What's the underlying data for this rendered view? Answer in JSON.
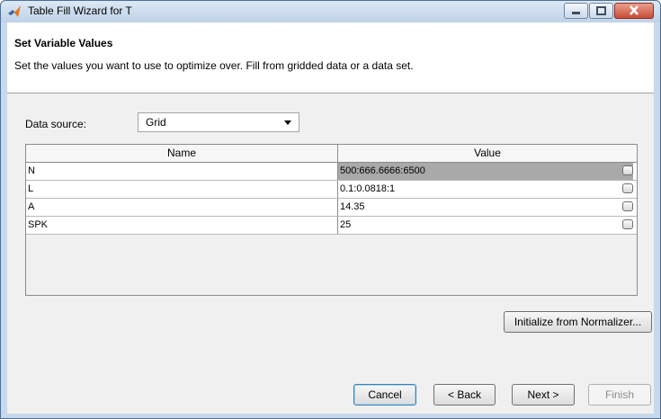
{
  "window": {
    "title": "Table Fill Wizard for T"
  },
  "header": {
    "title": "Set Variable Values",
    "description": "Set the values you want to use to optimize over. Fill from gridded data or a data set."
  },
  "data_source": {
    "label": "Data source:",
    "selected": "Grid"
  },
  "table": {
    "columns": [
      "Name",
      "Value"
    ],
    "rows": [
      {
        "name": "N",
        "value": "500:666.6666:6500",
        "selected": true
      },
      {
        "name": "L",
        "value": "0.1:0.0818:1",
        "selected": false
      },
      {
        "name": "A",
        "value": "14.35",
        "selected": false
      },
      {
        "name": "SPK",
        "value": "25",
        "selected": false
      }
    ]
  },
  "buttons": {
    "initialize": "Initialize from Normalizer...",
    "cancel": "Cancel",
    "back": "< Back",
    "next": "Next >",
    "finish": "Finish"
  },
  "icons": {
    "app": "matlab-logo-icon",
    "minimize": "minimize-icon",
    "maximize": "maximize-icon",
    "close": "close-icon",
    "dropdown": "chevron-down-icon",
    "cell_edit": "edit-cell-icon"
  },
  "colors": {
    "selected_row": "#a9a9a9",
    "close_button": "#c74c36",
    "title_bar": "#c9d9ec"
  }
}
